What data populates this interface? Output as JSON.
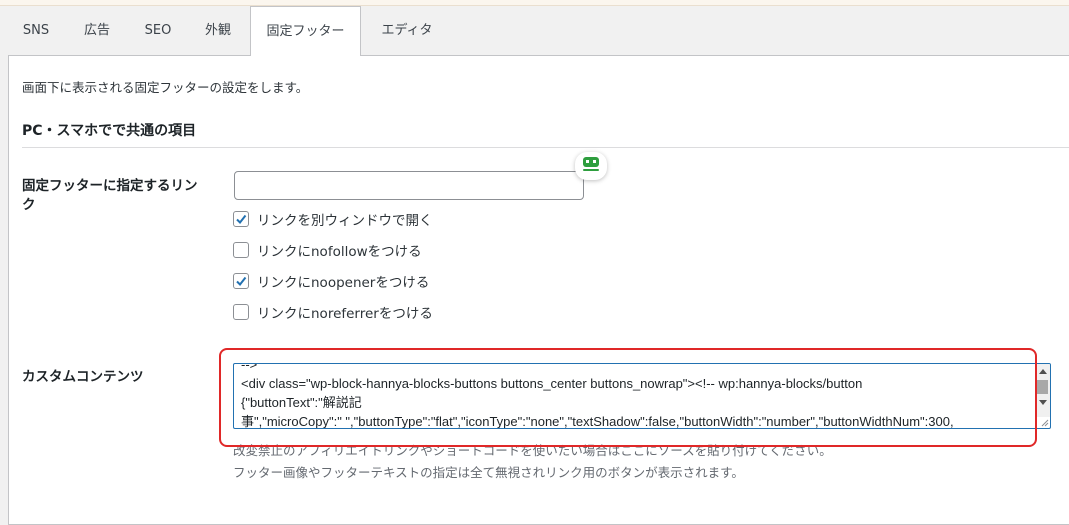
{
  "tabs": [
    {
      "label": "SNS"
    },
    {
      "label": "広告"
    },
    {
      "label": "SEO"
    },
    {
      "label": "外観"
    },
    {
      "label": "固定フッター",
      "active": true
    },
    {
      "label": "エディタ"
    }
  ],
  "description": "画面下に表示される固定フッターの設定をします。",
  "section_title": "PC・スマホでで共通の項目",
  "link_field": {
    "label_line1": "固定フッターに指定するリン",
    "label_line2": "ク",
    "value": ""
  },
  "checkboxes": [
    {
      "label": "リンクを別ウィンドウで開く",
      "checked": true
    },
    {
      "label": "リンクにnofollowをつける",
      "checked": false
    },
    {
      "label": "リンクにnoopenerをつける",
      "checked": true
    },
    {
      "label": "リンクにnoreferrerをつける",
      "checked": false
    }
  ],
  "custom_content": {
    "label": "カスタムコンテンツ",
    "lines": [
      "-->",
      "<div class=\"wp-block-hannya-blocks-buttons  buttons_center buttons_nowrap\"><!-- wp:hannya-blocks/button",
      "{\"buttonText\":\"解説記",
      "事\",\"microCopy\":\"     \",\"buttonType\":\"flat\",\"iconType\":\"none\",\"textShadow\":false,\"buttonWidth\":\"number\",\"buttonWidthNum\":300,"
    ],
    "notes": [
      "改変禁止のアフィリエイトリンクやショートコードを使いたい場合はここにソースを貼り付けてください。",
      "フッター画像やフッターテキストの指定は全て無視されリンク用のボタンが表示されます。"
    ]
  },
  "colors": {
    "accent": "#2271b1",
    "highlight": "#e02828",
    "badge": "#2e9e3e"
  }
}
